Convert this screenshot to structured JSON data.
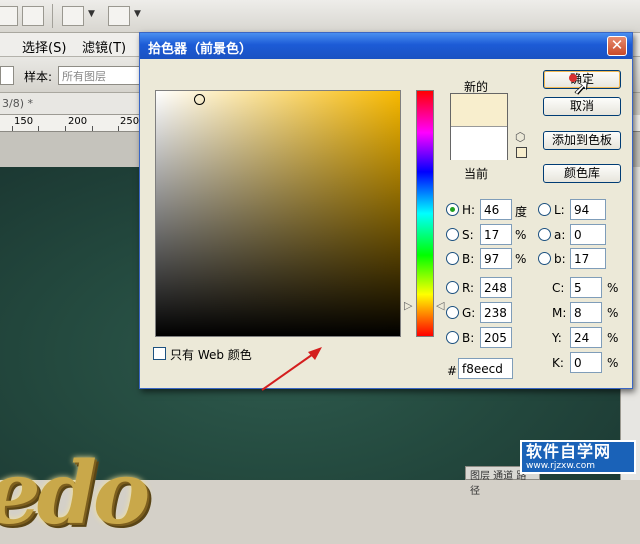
{
  "background": {
    "menu": [
      "选择(S)",
      "滤镜(T)"
    ],
    "options": {
      "sample_label": "样本:",
      "sample_value": "所有图层"
    },
    "doc_tab": "3/8) *",
    "ruler": [
      "150",
      "200",
      "250"
    ],
    "layers_tab": "图层  通道  路径",
    "canvas_text": "edo",
    "watermark": {
      "title": "软件自学网",
      "url": "www.rjzxw.com"
    }
  },
  "dialog": {
    "title": "拾色器（前景色）",
    "close": "✕",
    "new_label": "新的",
    "current_label": "当前",
    "new_color": "#f8eecd",
    "current_color": "#ffffff",
    "buttons": {
      "ok": "确定",
      "cancel": "取消",
      "add_to_swatches": "添加到色板",
      "color_libraries": "颜色库"
    },
    "web_only": "只有 Web 颜色",
    "hsb": [
      {
        "label": "H:",
        "value": "46",
        "unit": "度",
        "selected": true
      },
      {
        "label": "S:",
        "value": "17",
        "unit": "%",
        "selected": false
      },
      {
        "label": "B:",
        "value": "97",
        "unit": "%",
        "selected": false
      }
    ],
    "rgb": [
      {
        "label": "R:",
        "value": "248"
      },
      {
        "label": "G:",
        "value": "238"
      },
      {
        "label": "B:",
        "value": "205"
      }
    ],
    "lab": [
      {
        "label": "L:",
        "value": "94"
      },
      {
        "label": "a:",
        "value": "0"
      },
      {
        "label": "b:",
        "value": "17"
      }
    ],
    "cmyk": [
      {
        "label": "C:",
        "value": "5",
        "unit": "%"
      },
      {
        "label": "M:",
        "value": "8",
        "unit": "%"
      },
      {
        "label": "Y:",
        "value": "24",
        "unit": "%"
      },
      {
        "label": "K:",
        "value": "0",
        "unit": "%"
      }
    ],
    "hex_label": "#",
    "hex": "f8eecd"
  }
}
